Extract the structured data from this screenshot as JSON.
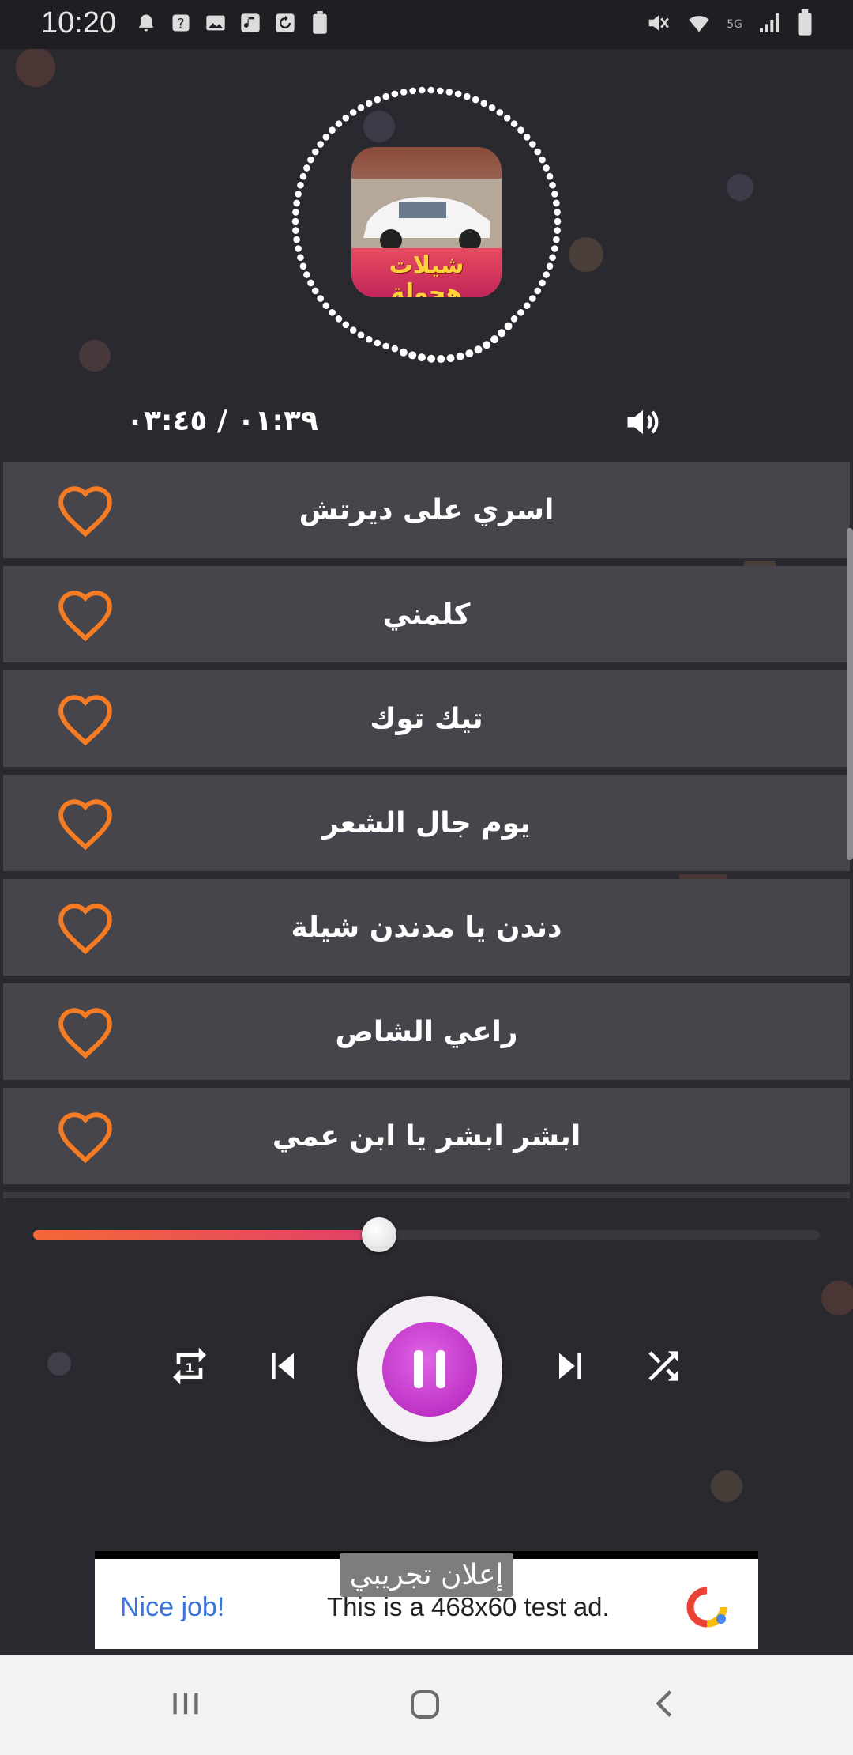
{
  "status_bar": {
    "time": "10:20",
    "left_icons": [
      "bell-icon",
      "help-icon",
      "image-icon",
      "music-icon",
      "sync-icon",
      "battery-saver-icon"
    ],
    "right_icons": [
      "mute-icon",
      "wifi-icon",
      "5g-icon",
      "signal-icon",
      "battery-icon"
    ],
    "network_label": "5G"
  },
  "player": {
    "time_readout": "٠١:٣٩ / ٠٣:٤٥",
    "album_art_caption": "شيلات هجولة",
    "progress": 0.44
  },
  "tracks": [
    {
      "title": "اسري على ديرتش"
    },
    {
      "title": "كلمني"
    },
    {
      "title": "تيك توك"
    },
    {
      "title": "يوم جال الشعر"
    },
    {
      "title": "دندن يا مدندن شيلة"
    },
    {
      "title": "راعي الشاص"
    },
    {
      "title": "ابشر ابشر يا ابن عمي"
    }
  ],
  "ad": {
    "label": "إعلان تجريبي",
    "nice": "Nice job!",
    "text": "This is a 468x60 test ad."
  },
  "colors": {
    "accent_orange": "#f57c22",
    "play_magenta": "#c02ac6",
    "row_bg": "#46454b"
  }
}
